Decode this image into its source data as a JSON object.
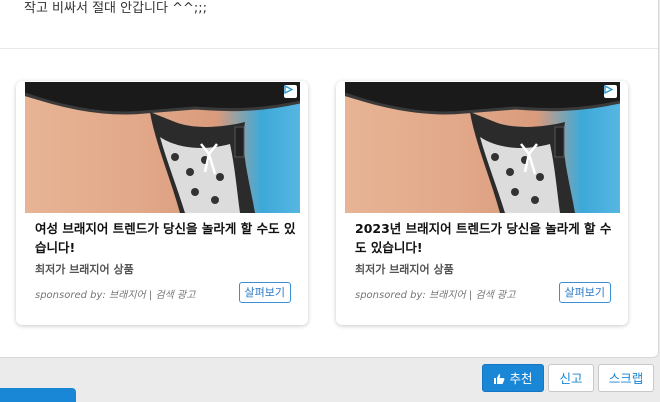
{
  "post": {
    "text": "작고 비싸서 절대 안갑니다 ^^;;;"
  },
  "ads": [
    {
      "title": "여성 브래지어 트렌드가 당신을 놀라게 할 수도 있습니다!",
      "subtitle": "최저가 브래지어 상품",
      "sponsor": "sponsored by: 브래지어 | 검색 광고",
      "cta": "살펴보기",
      "adchoice_icon": "adchoices-icon"
    },
    {
      "title": "2023년 브래지어 트렌드가 당신을 놀라게 할 수도 있습니다!",
      "subtitle": "최저가 브래지어 상품",
      "sponsor": "sponsored by: 브래지어 | 검색 광고",
      "cta": "살펴보기",
      "adchoice_icon": "adchoices-icon"
    }
  ],
  "actions": {
    "recommend_label": "추천",
    "recommend_icon": "thumbs-up-icon",
    "report_label": "신고",
    "scrap_label": "스크랩"
  },
  "colors": {
    "accent": "#1a86d6",
    "background": "#ebebeb"
  }
}
